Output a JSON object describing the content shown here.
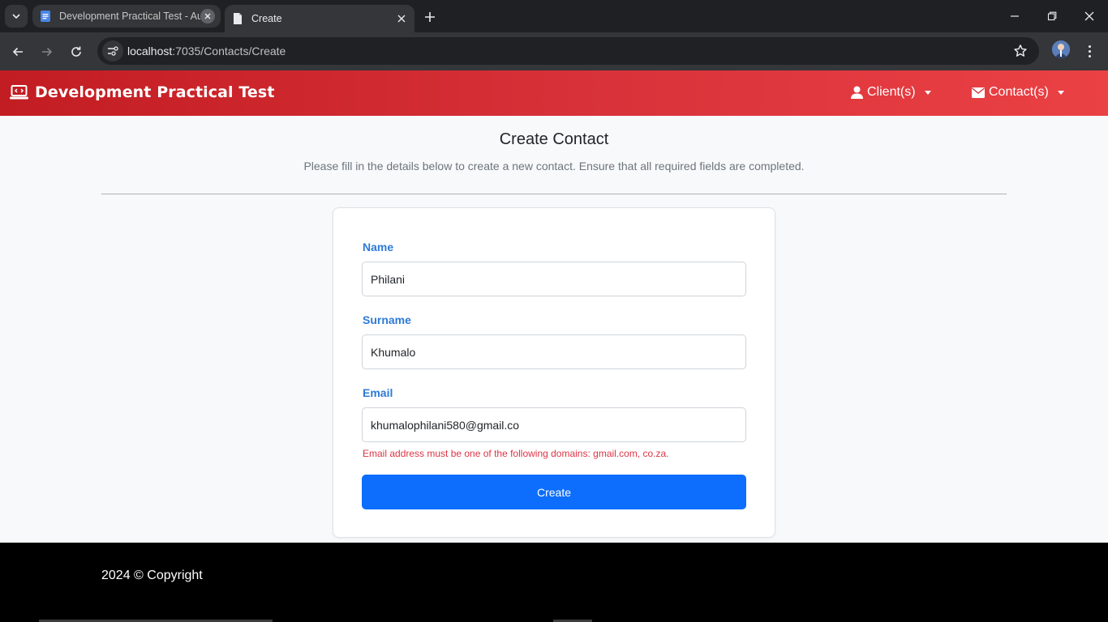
{
  "browser": {
    "tabs": [
      {
        "title": "Development Practical Test - Au",
        "active": false
      },
      {
        "title": "Create",
        "active": true
      }
    ],
    "address": {
      "host": "localhost",
      "path": ":7035/Contacts/Create"
    }
  },
  "app": {
    "brand": "Development Practical Test",
    "nav": {
      "clients": "Client(s)",
      "contacts": "Contact(s)"
    }
  },
  "page": {
    "title": "Create Contact",
    "subtitle": "Please fill in the details below to create a new contact. Ensure that all required fields are completed."
  },
  "form": {
    "name": {
      "label": "Name",
      "value": "Philani"
    },
    "surname": {
      "label": "Surname",
      "value": "Khumalo"
    },
    "email": {
      "label": "Email",
      "value": "khumalophilani580@gmail.co",
      "error": "Email address must be one of the following domains: gmail.com, co.za."
    },
    "submit_label": "Create"
  },
  "footer": {
    "copyright": "2024 © Copyright"
  },
  "colors": {
    "navbar_start": "#c21d22",
    "navbar_end": "#ea4144",
    "label": "#2d7ad6",
    "primary_button": "#0d6efd",
    "error": "#dc3545"
  }
}
